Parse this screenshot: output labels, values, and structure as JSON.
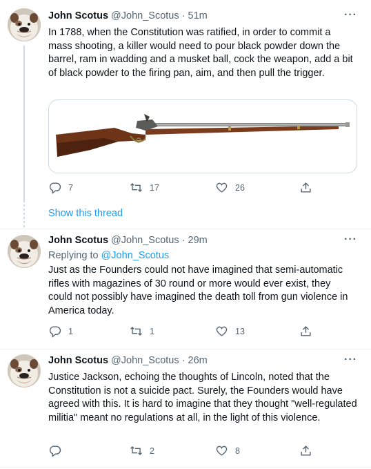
{
  "tweets": [
    {
      "name": "John Scotus",
      "handle": "@John_Scotus",
      "sep": "·",
      "time": "51m",
      "more": "···",
      "text": "In 1788, when the Constitution was ratified, in order to commit a mass shooting, a killer would need to pour black powder down the barrel, ram in wadding and a musket ball, cock the weapon, add a bit of black powder to the firing pan, aim, and then pull the trigger.",
      "replies": "7",
      "retweets": "17",
      "likes": "26",
      "show_thread": "Show this thread"
    },
    {
      "name": "John Scotus",
      "handle": "@John_Scotus",
      "sep": "·",
      "time": "29m",
      "more": "···",
      "replying_label": "Replying to",
      "replying_handle": "@John_Scotus",
      "text": "Just as the Founders could not have imagined that semi-automatic rifles with magazines of 30 round or more would ever exist, they could not possibly have imagined the death toll from gun violence in America today.",
      "replies": "1",
      "retweets": "1",
      "likes": "13"
    },
    {
      "name": "John Scotus",
      "handle": "@John_Scotus",
      "sep": "·",
      "time": "26m",
      "more": "···",
      "text": "Justice Jackson, echoing the thoughts of Lincoln, noted that the Constitution is not a suicide pact. Surely, the Founders would have agreed with this. It is hard to imagine that they thought \"well-regulated militia\" meant no regulations at all, in the light of this violence.",
      "replies": "",
      "retweets": "2",
      "likes": "8"
    }
  ],
  "colors": {
    "accent": "#1d9bf0",
    "text": "#0f1419",
    "muted": "#536471",
    "border": "#cfd9de"
  },
  "icons": [
    "bulldog-avatar",
    "reply-icon",
    "retweet-icon",
    "like-icon",
    "share-icon",
    "more-icon",
    "musket-image"
  ]
}
